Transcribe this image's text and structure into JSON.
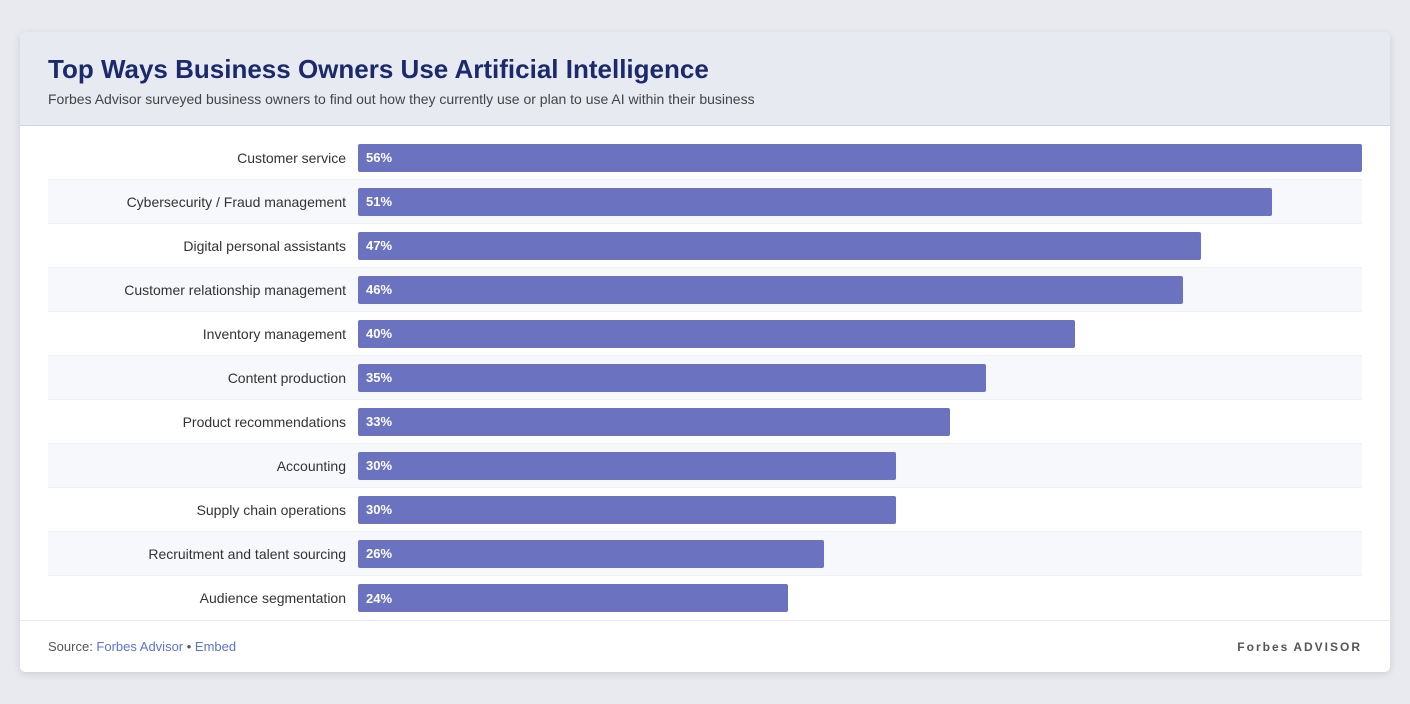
{
  "header": {
    "title": "Top Ways Business Owners Use Artificial Intelligence",
    "subtitle": "Forbes Advisor surveyed business owners to find out how they currently use or plan to use AI within their business"
  },
  "chart": {
    "max_percent": 56,
    "bars": [
      {
        "label": "Customer service",
        "value": 56,
        "display": "56%",
        "row_class": "odd"
      },
      {
        "label": "Cybersecurity / Fraud management",
        "value": 51,
        "display": "51%",
        "row_class": "even"
      },
      {
        "label": "Digital personal assistants",
        "value": 47,
        "display": "47%",
        "row_class": "odd"
      },
      {
        "label": "Customer relationship management",
        "value": 46,
        "display": "46%",
        "row_class": "even"
      },
      {
        "label": "Inventory management",
        "value": 40,
        "display": "40%",
        "row_class": "odd"
      },
      {
        "label": "Content production",
        "value": 35,
        "display": "35%",
        "row_class": "even"
      },
      {
        "label": "Product recommendations",
        "value": 33,
        "display": "33%",
        "row_class": "odd"
      },
      {
        "label": "Accounting",
        "value": 30,
        "display": "30%",
        "row_class": "even"
      },
      {
        "label": "Supply chain operations",
        "value": 30,
        "display": "30%",
        "row_class": "odd"
      },
      {
        "label": "Recruitment and talent sourcing",
        "value": 26,
        "display": "26%",
        "row_class": "even"
      },
      {
        "label": "Audience segmentation",
        "value": 24,
        "display": "24%",
        "row_class": "odd"
      }
    ]
  },
  "footer": {
    "source_label": "Source: ",
    "source_link_text": "Forbes Advisor",
    "source_separator": " • ",
    "embed_label": "Embed",
    "logo_bold": "Forbes",
    "logo_light": "ADVISOR"
  }
}
